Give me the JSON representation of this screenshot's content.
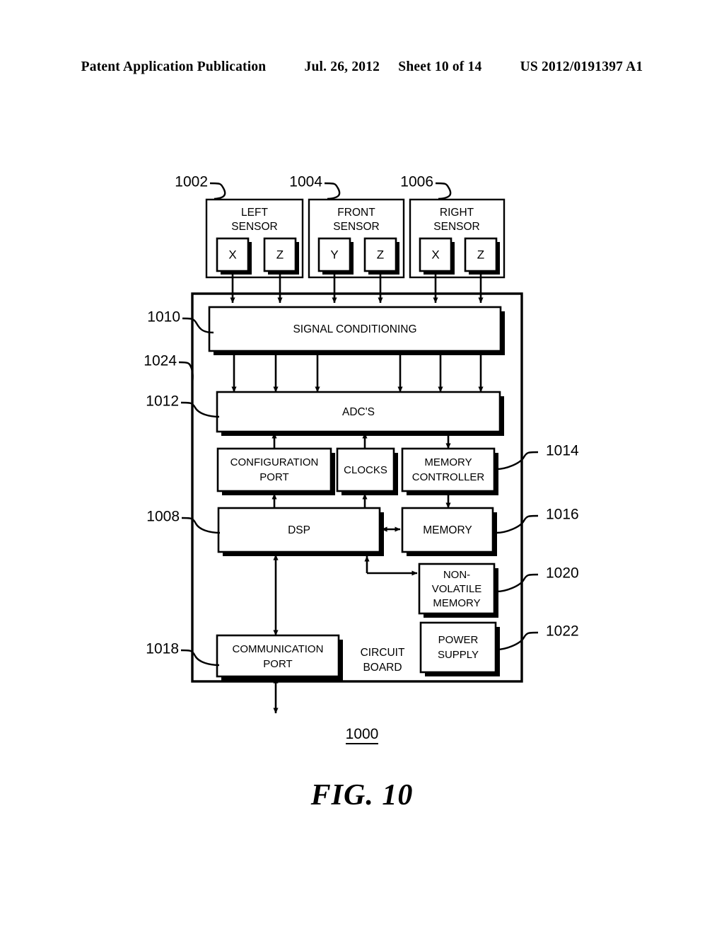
{
  "header": {
    "publication": "Patent Application Publication",
    "date": "Jul. 26, 2012",
    "sheet": "Sheet 10 of 14",
    "pub_number": "US 2012/0191397 A1"
  },
  "figure": {
    "caption": "FIG. 10",
    "figure_ref": "1000",
    "board_label_line1": "CIRCUIT",
    "board_label_line2": "BOARD"
  },
  "sensors": [
    {
      "ref": "1002",
      "title_line1": "LEFT",
      "title_line2": "SENSOR",
      "axes": [
        "X",
        "Z"
      ]
    },
    {
      "ref": "1004",
      "title_line1": "FRONT",
      "title_line2": "SENSOR",
      "axes": [
        "Y",
        "Z"
      ]
    },
    {
      "ref": "1006",
      "title_line1": "RIGHT",
      "title_line2": "SENSOR",
      "axes": [
        "X",
        "Z"
      ]
    }
  ],
  "blocks": {
    "signal_conditioning": {
      "ref": "1010",
      "label": "SIGNAL CONDITIONING"
    },
    "adcs": {
      "ref": "1012",
      "label": "ADC'S"
    },
    "configuration_port": {
      "label_line1": "CONFIGURATION",
      "label_line2": "PORT"
    },
    "clocks": {
      "label": "CLOCKS"
    },
    "memory_controller": {
      "ref": "1014",
      "label_line1": "MEMORY",
      "label_line2": "CONTROLLER"
    },
    "dsp": {
      "ref": "1008",
      "label": "DSP"
    },
    "memory": {
      "ref": "1016",
      "label": "MEMORY"
    },
    "non_volatile_memory": {
      "ref": "1020",
      "label_line1": "NON-",
      "label_line2": "VOLATILE",
      "label_line3": "MEMORY"
    },
    "power_supply": {
      "ref": "1022",
      "label_line1": "POWER",
      "label_line2": "SUPPLY"
    },
    "communication_port": {
      "ref": "1018",
      "label_line1": "COMMUNICATION",
      "label_line2": "PORT"
    },
    "circuit_board": {
      "ref": "1024"
    }
  }
}
